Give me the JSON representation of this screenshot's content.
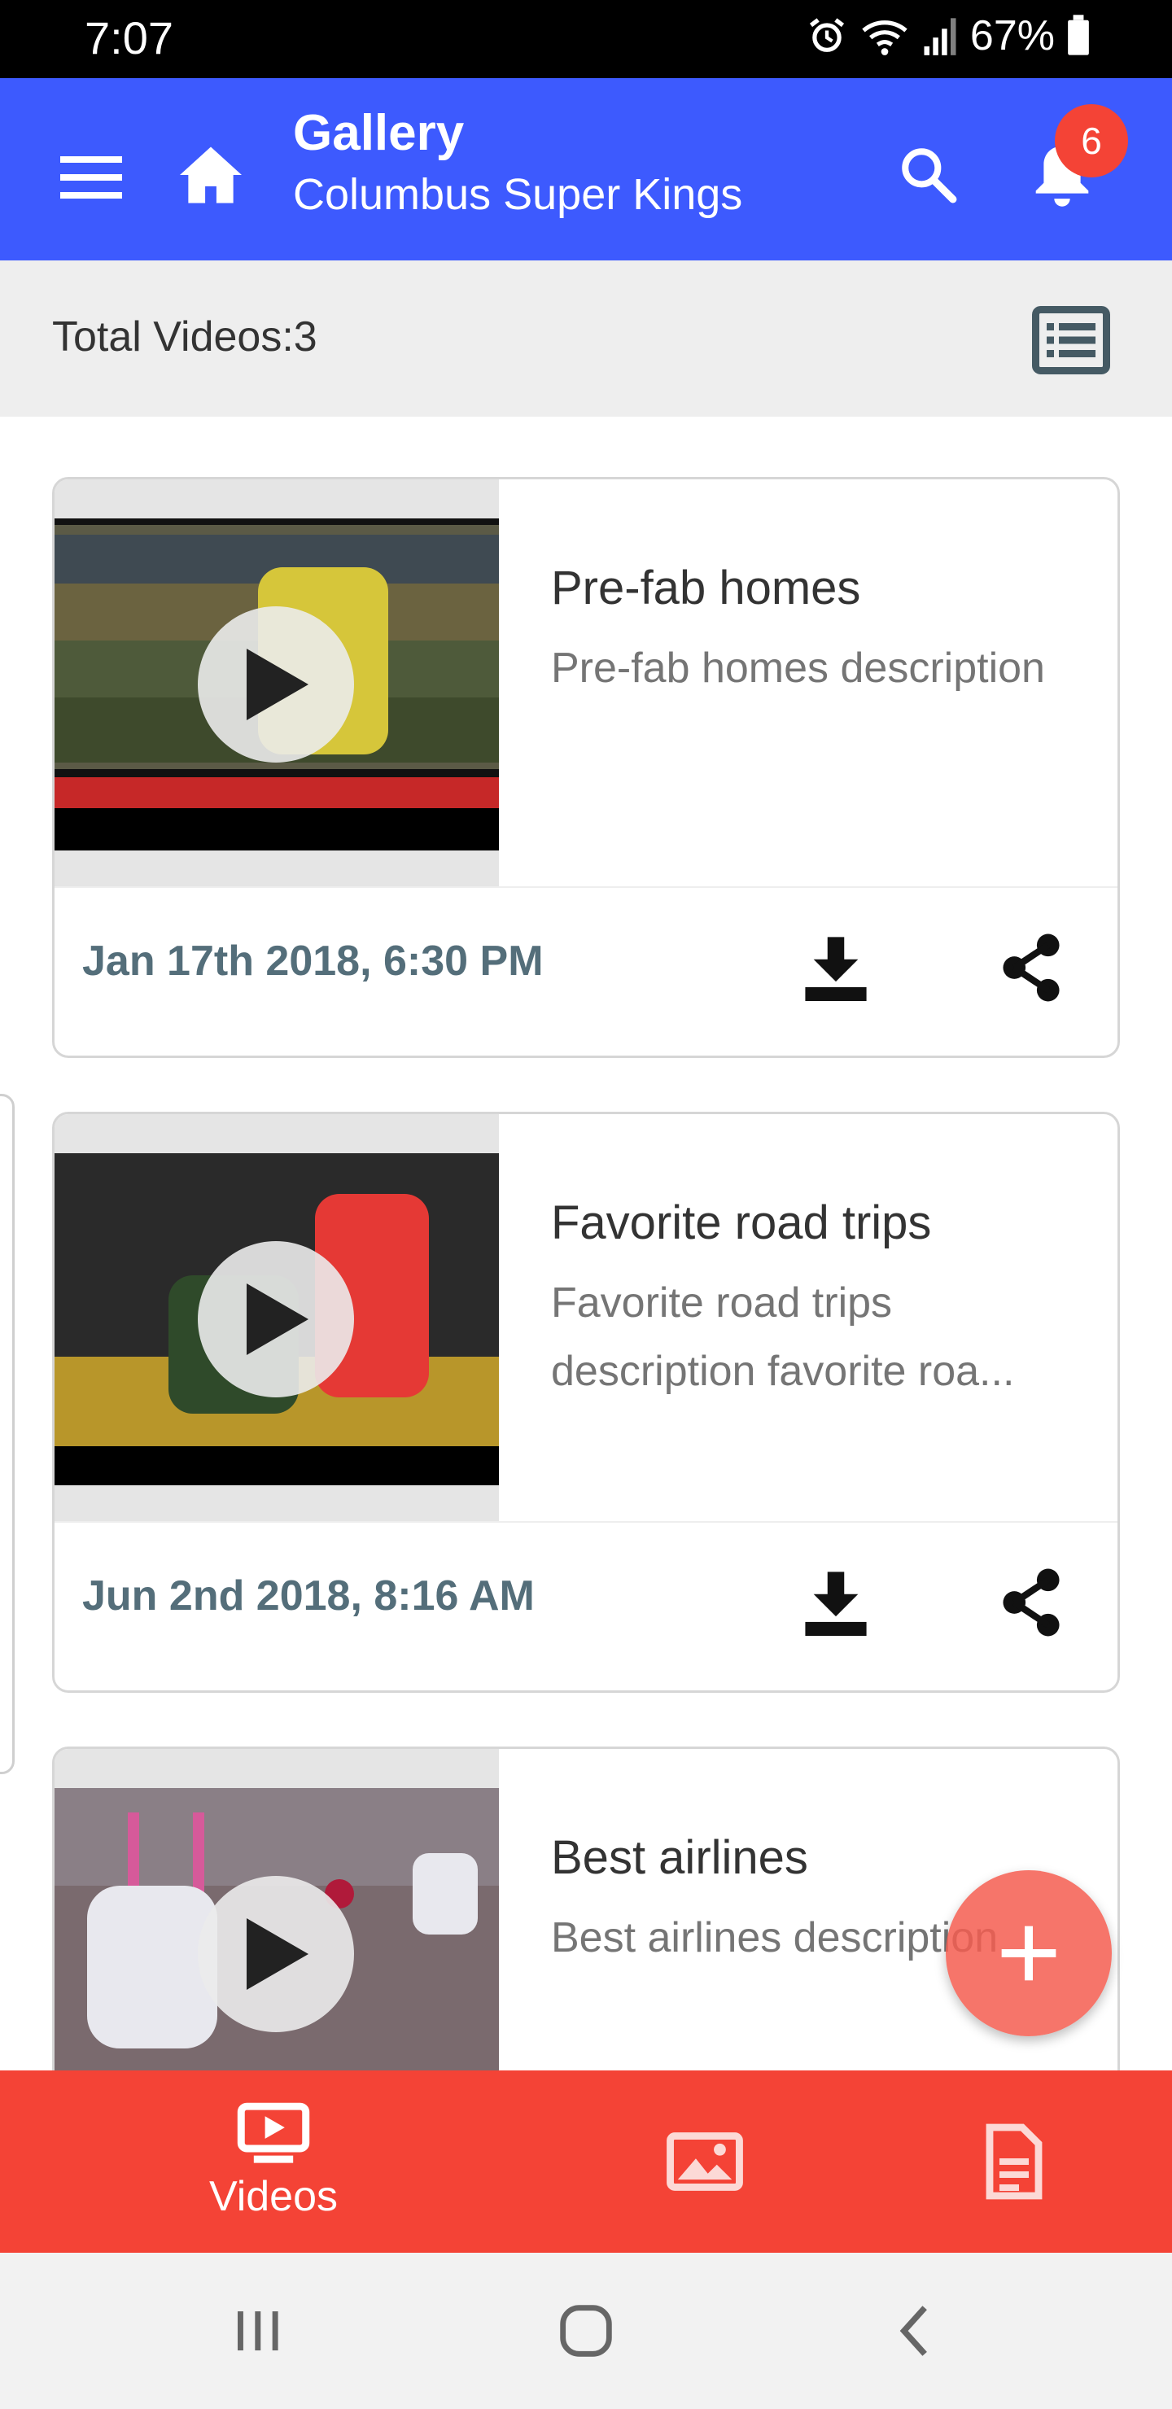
{
  "status_bar": {
    "time": "7:07",
    "battery": "67%"
  },
  "app_bar": {
    "title": "Gallery",
    "subtitle": "Columbus Super Kings",
    "notification_count": "6",
    "color": "#3d5afe"
  },
  "summary": {
    "total_videos_label": "Total Videos:3"
  },
  "videos": [
    {
      "title": "Pre-fab homes",
      "description": "Pre-fab homes description",
      "date": "Jan 17th 2018, 6:30 PM"
    },
    {
      "title": "Favorite road trips",
      "description": "Favorite road trips description favorite roa...",
      "date": "Jun 2nd 2018, 8:16 AM"
    },
    {
      "title": "Best airlines",
      "description": "Best airlines description",
      "date": ""
    }
  ],
  "bottom_nav": {
    "color": "#f44336",
    "items": [
      {
        "label": "Videos",
        "icon": "video-icon",
        "active": true
      },
      {
        "label": "",
        "icon": "image-icon",
        "active": false
      },
      {
        "label": "",
        "icon": "document-icon",
        "active": false
      }
    ]
  },
  "icons": {
    "menu": "menu-icon",
    "home": "home-icon",
    "search": "search-icon",
    "bell": "bell-icon",
    "list_view": "list-view-icon",
    "play": "play-icon",
    "download": "download-icon",
    "share": "share-icon",
    "add": "plus-icon"
  }
}
